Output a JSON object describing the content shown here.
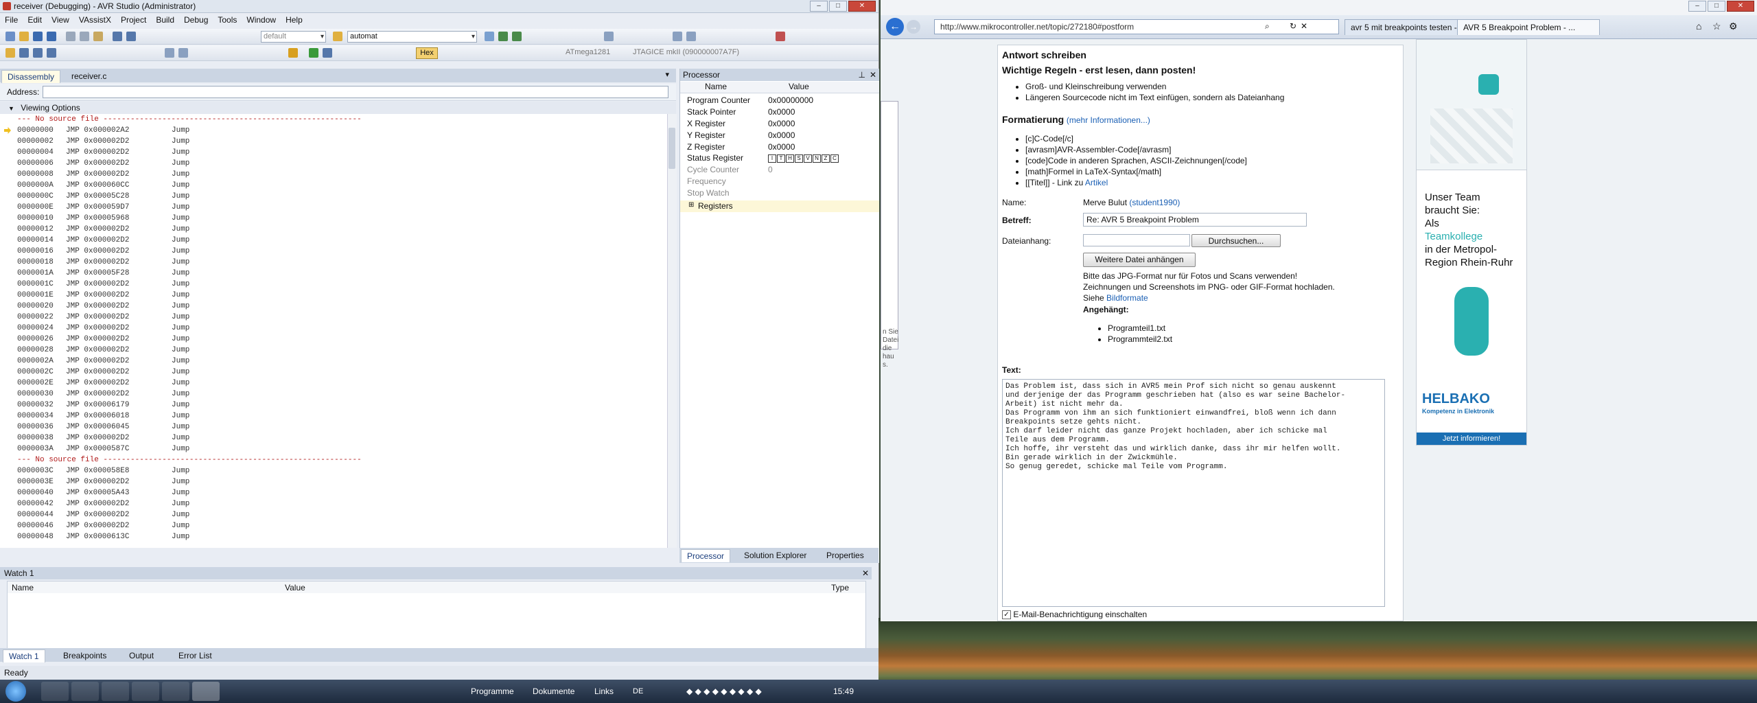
{
  "avr": {
    "title": "receiver (Debugging) - AVR Studio (Administrator)",
    "menu": [
      "File",
      "Edit",
      "View",
      "VAssistX",
      "Project",
      "Build",
      "Debug",
      "Tools",
      "Window",
      "Help"
    ],
    "combo_config": "default",
    "combo_search": "automat",
    "hex_label": "Hex",
    "device": "ATmega1281",
    "tool": "JTAGICE mkII (090000007A7F)",
    "tabs": [
      "Disassembly",
      "receiver.c"
    ],
    "address_label": "Address:",
    "viewing_options": "Viewing Options",
    "no_source": "--- No source file ---------------------------------------------------------",
    "block1": [
      [
        "00000000",
        "JMP 0x000002A2",
        "Jump"
      ],
      [
        "00000002",
        "JMP 0x000002D2",
        "Jump"
      ],
      [
        "00000004",
        "JMP 0x000002D2",
        "Jump"
      ],
      [
        "00000006",
        "JMP 0x000002D2",
        "Jump"
      ],
      [
        "00000008",
        "JMP 0x000002D2",
        "Jump"
      ],
      [
        "0000000A",
        "JMP 0x000060CC",
        "Jump"
      ],
      [
        "0000000C",
        "JMP 0x00005C28",
        "Jump"
      ],
      [
        "0000000E",
        "JMP 0x000059D7",
        "Jump"
      ],
      [
        "00000010",
        "JMP 0x00005968",
        "Jump"
      ],
      [
        "00000012",
        "JMP 0x000002D2",
        "Jump"
      ],
      [
        "00000014",
        "JMP 0x000002D2",
        "Jump"
      ],
      [
        "00000016",
        "JMP 0x000002D2",
        "Jump"
      ],
      [
        "00000018",
        "JMP 0x000002D2",
        "Jump"
      ],
      [
        "0000001A",
        "JMP 0x00005F28",
        "Jump"
      ],
      [
        "0000001C",
        "JMP 0x000002D2",
        "Jump"
      ],
      [
        "0000001E",
        "JMP 0x000002D2",
        "Jump"
      ],
      [
        "00000020",
        "JMP 0x000002D2",
        "Jump"
      ],
      [
        "00000022",
        "JMP 0x000002D2",
        "Jump"
      ],
      [
        "00000024",
        "JMP 0x000002D2",
        "Jump"
      ],
      [
        "00000026",
        "JMP 0x000002D2",
        "Jump"
      ],
      [
        "00000028",
        "JMP 0x000002D2",
        "Jump"
      ],
      [
        "0000002A",
        "JMP 0x000002D2",
        "Jump"
      ],
      [
        "0000002C",
        "JMP 0x000002D2",
        "Jump"
      ],
      [
        "0000002E",
        "JMP 0x000002D2",
        "Jump"
      ],
      [
        "00000030",
        "JMP 0x000002D2",
        "Jump"
      ],
      [
        "00000032",
        "JMP 0x00006179",
        "Jump"
      ],
      [
        "00000034",
        "JMP 0x00006018",
        "Jump"
      ],
      [
        "00000036",
        "JMP 0x00006045",
        "Jump"
      ],
      [
        "00000038",
        "JMP 0x000002D2",
        "Jump"
      ],
      [
        "0000003A",
        "JMP 0x0000587C",
        "Jump"
      ]
    ],
    "block2": [
      [
        "0000003C",
        "JMP 0x000058E8",
        "Jump"
      ],
      [
        "0000003E",
        "JMP 0x000002D2",
        "Jump"
      ],
      [
        "00000040",
        "JMP 0x00005A43",
        "Jump"
      ],
      [
        "00000042",
        "JMP 0x000002D2",
        "Jump"
      ],
      [
        "00000044",
        "JMP 0x000002D2",
        "Jump"
      ],
      [
        "00000046",
        "JMP 0x000002D2",
        "Jump"
      ],
      [
        "00000048",
        "JMP 0x0000613C",
        "Jump"
      ]
    ],
    "processor": {
      "title": "Processor",
      "col_name": "Name",
      "col_value": "Value",
      "rows": [
        [
          "Program Counter",
          "0x00000000"
        ],
        [
          "Stack Pointer",
          "0x0000"
        ],
        [
          "X Register",
          "0x0000"
        ],
        [
          "Y Register",
          "0x0000"
        ],
        [
          "Z Register",
          "0x0000"
        ]
      ],
      "status_label": "Status Register",
      "status_bits": [
        "I",
        "T",
        "H",
        "S",
        "V",
        "N",
        "Z",
        "C"
      ],
      "dim_rows": [
        [
          "Cycle Counter",
          "0"
        ],
        [
          "Frequency",
          ""
        ],
        [
          "Stop Watch",
          ""
        ]
      ],
      "registers": "Registers",
      "tabs": [
        "Processor",
        "Solution Explorer",
        "Properties"
      ]
    },
    "watch": {
      "title": "Watch 1",
      "cols": [
        "Name",
        "Value",
        "Type"
      ]
    },
    "bottom_tabs": [
      "Watch 1",
      "Breakpoints",
      "Output",
      "Error List"
    ],
    "status": "Ready"
  },
  "browser": {
    "url": "http://www.mikrocontroller.net/topic/272180#postform",
    "tabs": [
      "avr 5 mit breakpoints testen - ...",
      "AVR 5 Breakpoint Problem - ..."
    ],
    "heading": "Antwort schreiben",
    "rules_heading": "Wichtige Regeln - erst lesen, dann posten!",
    "rules": [
      "Groß- und Kleinschreibung verwenden",
      "Längeren Sourcecode nicht im Text einfügen, sondern als Dateianhang"
    ],
    "format_heading": "Formatierung",
    "format_link": "(mehr Informationen...)",
    "format_items": [
      "[c]C-Code[/c]",
      "[avrasm]AVR-Assembler-Code[/avrasm]",
      "[code]Code in anderen Sprachen, ASCII-Zeichnungen[/code]",
      "[math]Formel in LaTeX-Syntax[/math]"
    ],
    "format_last_prefix": "[[Titel]] - Link zu ",
    "format_last_link": "Artikel",
    "name_label": "Name:",
    "name_value": "Merve Bulut",
    "name_user": "(student1990)",
    "subject_label": "Betreff:",
    "subject_value": "Re: AVR 5 Breakpoint Problem",
    "attach_label": "Dateianhang:",
    "browse_btn": "Durchsuchen...",
    "more_files_btn": "Weitere Datei anhängen",
    "photo_note": "Bitte das JPG-Format nur für Fotos und Scans verwenden!",
    "drawing_note": "Zeichnungen und Screenshots im PNG- oder GIF-Format hochladen.",
    "see_prefix": "Siehe ",
    "see_link": "Bildformate",
    "attached_label": "Angehängt:",
    "attached": [
      "Programteil1.txt",
      "Programmteil2.txt"
    ],
    "text_label": "Text:",
    "text_body": "Das Problem ist, dass sich in AVR5 mein Prof sich nicht so genau auskennt\nund derjenige der das Programm geschrieben hat (also es war seine Bachelor-\nArbeit) ist nicht mehr da.\nDas Programm von ihm an sich funktioniert einwandfrei, bloß wenn ich dann\nBreakpoints setze gehts nicht.\nIch darf leider nicht das ganze Projekt hochladen, aber ich schicke mal\nTeile aus dem Programm.\nIch hoffe, ihr versteht das und wirklich danke, dass ihr mir helfen wollt.\nBin gerade wirklich in der Zwickmühle.\nSo genug geredet, schicke mal Teile vom Programm.",
    "email_notify": "E-Mail-Benachrichtigung einschalten",
    "side_snippet": [
      "n Sie",
      "Datei",
      "die",
      "hau",
      "s."
    ],
    "ad": {
      "line1": "Unser Team",
      "line2": "braucht Sie:",
      "line3": "Als",
      "line4": "Teamkollege",
      "line5": "in der Metropol-",
      "line6": "Region Rhein-Ruhr",
      "brand": "HELBAKO",
      "tagline": "Kompetenz in Elektronik",
      "cta": "Jetzt informieren!"
    }
  },
  "taskbar": {
    "items": [
      "Programme",
      "Dokumente",
      "Links"
    ],
    "lang": "DE",
    "clock": "15:49"
  },
  "colors": {
    "accent": "#1a5fb4",
    "nosrc": "#b11a1a",
    "ad_teal": "#2ab0b0",
    "ad_blue": "#1a6fb3"
  }
}
